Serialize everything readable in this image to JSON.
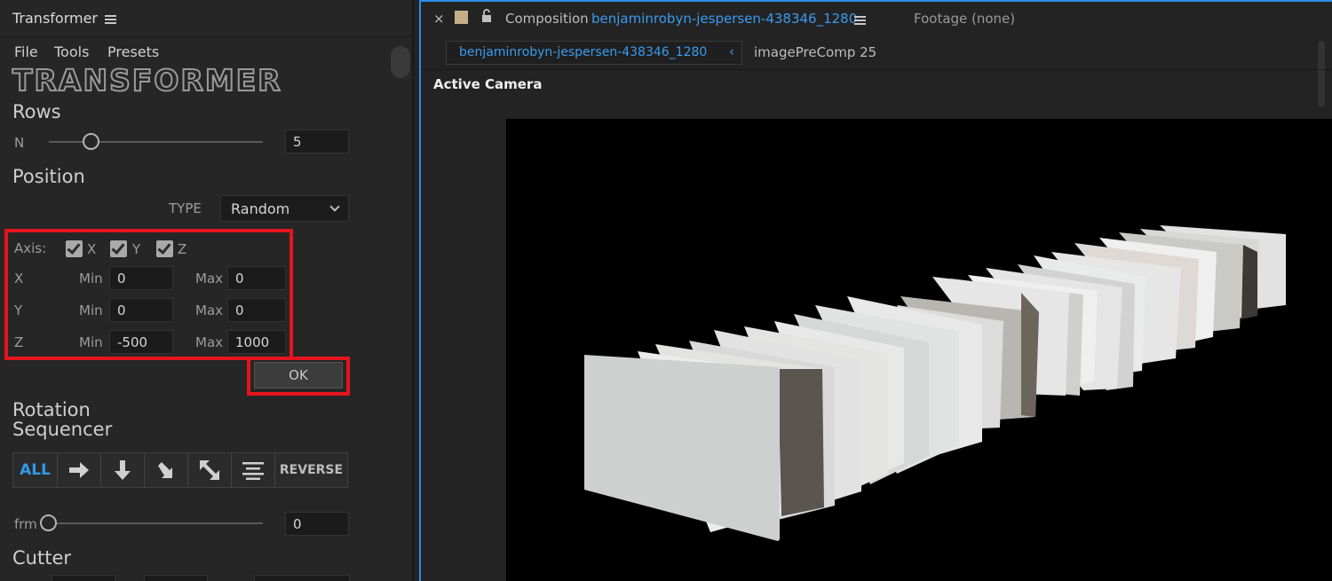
{
  "left_panel": {
    "title": "Transformer",
    "menu": [
      "File",
      "Tools",
      "Presets"
    ],
    "logo": "TRANSFORMER",
    "rows": {
      "heading": "Rows",
      "n_label": "N",
      "n_value": "5",
      "slider_fraction": 0.2
    },
    "position": {
      "heading": "Position",
      "type_label": "TYPE",
      "type_value": "Random",
      "axis_label": "Axis:",
      "axes": [
        {
          "label": "X",
          "checked": true
        },
        {
          "label": "Y",
          "checked": true
        },
        {
          "label": "Z",
          "checked": true
        }
      ],
      "min_label": "Min",
      "max_label": "Max",
      "ranges": [
        {
          "axis": "X",
          "min": "0",
          "max": "0"
        },
        {
          "axis": "Y",
          "min": "0",
          "max": "0"
        },
        {
          "axis": "Z",
          "min": "-500",
          "max": "1000"
        }
      ],
      "ok_label": "OK"
    },
    "rotation": {
      "heading_line1": "Rotation",
      "heading_line2": "Sequencer",
      "buttons": {
        "all": "ALL",
        "reverse": "REVERSE"
      },
      "frm_label": "frm",
      "frm_value": "0"
    },
    "cutter_heading": "Cutter"
  },
  "right_panel": {
    "close": "×",
    "composition_label": "Composition",
    "composition_name": "benjaminrobyn-jespersen-438346_1280",
    "footage_label": "Footage",
    "footage_value": "(none)",
    "breadcrumb_active": "benjaminrobyn-jespersen-438346_1280",
    "breadcrumb_next": "imagePreComp 25",
    "viewer_label": "Active Camera"
  },
  "colors": {
    "accent_blue": "#3a9bf0",
    "highlight_red": "#e5141e",
    "panel_bg": "#262626",
    "viewer_bg": "#000000"
  }
}
